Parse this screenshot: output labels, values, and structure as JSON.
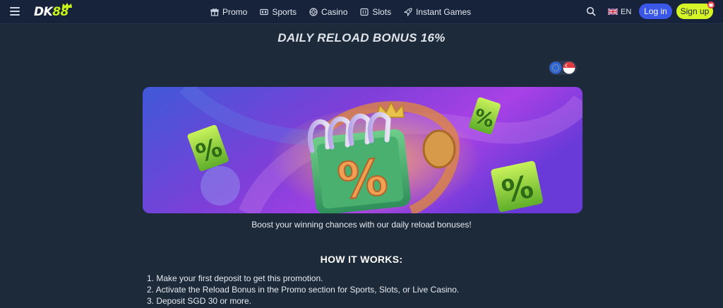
{
  "header": {
    "logo": "DK88",
    "nav": [
      {
        "label": "Promo",
        "icon": "gift-icon"
      },
      {
        "label": "Sports",
        "icon": "ticket-icon"
      },
      {
        "label": "Casino",
        "icon": "chip-icon"
      },
      {
        "label": "Slots",
        "icon": "slot-machine-icon"
      },
      {
        "label": "Instant Games",
        "icon": "rocket-icon"
      }
    ],
    "language": "EN",
    "login_label": "Log in",
    "signup_label": "Sign up"
  },
  "main": {
    "title": "DAILY RELOAD BONUS 16%",
    "subtitle": "Boost your winning chances with our daily reload bonuses!",
    "how_title": "HOW IT WORKS:",
    "steps": [
      "1. Make your first deposit to get this promotion.",
      "2. Activate the Reload Bonus in the Promo section for Sports, Slots, or Live Casino.",
      "3. Deposit SGD 30 or more."
    ]
  },
  "colors": {
    "background": "#1d2a3a",
    "header": "#17233a",
    "login": "#3a57e8",
    "signup": "#d5f528"
  }
}
